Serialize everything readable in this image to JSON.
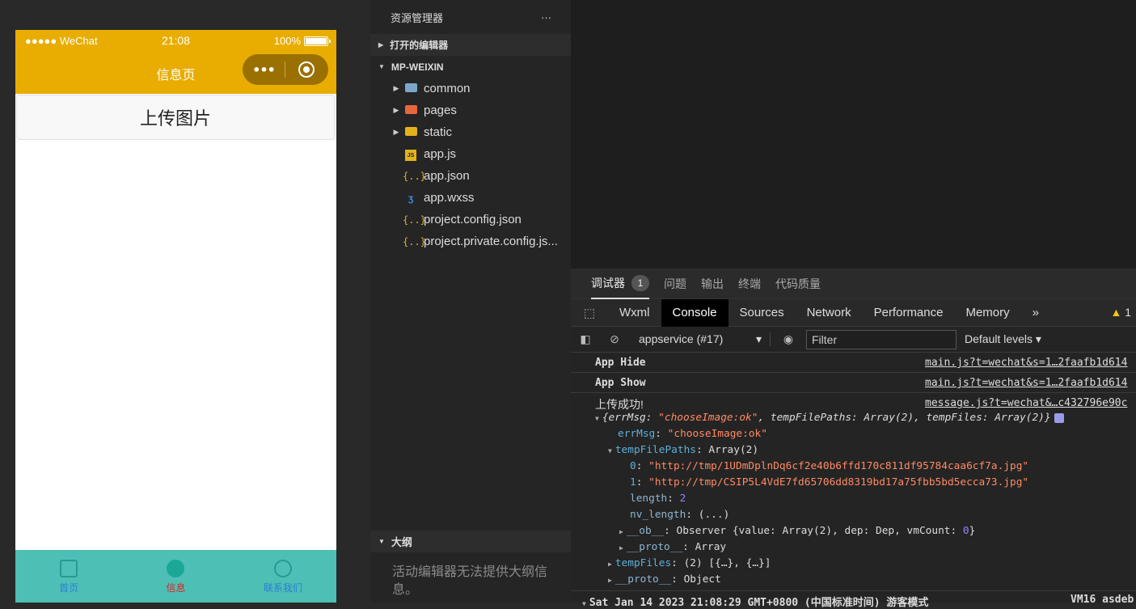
{
  "simulator": {
    "status": {
      "carrier": "●●●●● WeChat",
      "time": "21:08",
      "battery": "100%"
    },
    "nav_title": "信息页",
    "capsule_dots": "•••",
    "upload_button": "上传图片",
    "tabs": [
      {
        "label": "首页"
      },
      {
        "label": "信息"
      },
      {
        "label": "联系我们"
      }
    ]
  },
  "explorer": {
    "title": "资源管理器",
    "more": "···",
    "open_editors": "打开的编辑器",
    "project": "MP-WEIXIN",
    "items": [
      {
        "name": "common",
        "icon": "folder-icon",
        "color": "#7aa7c7"
      },
      {
        "name": "pages",
        "icon": "folder-icon",
        "color": "#e8663c"
      },
      {
        "name": "static",
        "icon": "folder-icon",
        "color": "#e2b21b"
      },
      {
        "name": "app.js",
        "icon": "js-file-icon"
      },
      {
        "name": "app.json",
        "icon": "json-file-icon"
      },
      {
        "name": "app.wxss",
        "icon": "wxss-file-icon"
      },
      {
        "name": "project.config.json",
        "icon": "json-file-icon"
      },
      {
        "name": "project.private.config.js...",
        "icon": "json-file-icon"
      }
    ],
    "outline_title": "大纲",
    "outline_message": "活动编辑器无法提供大纲信息。"
  },
  "debugger": {
    "top_tabs": [
      {
        "label": "调试器",
        "badge": "1"
      },
      {
        "label": "问题"
      },
      {
        "label": "输出"
      },
      {
        "label": "终端"
      },
      {
        "label": "代码质量"
      }
    ],
    "dev_tabs": [
      "Wxml",
      "Console",
      "Sources",
      "Network",
      "Performance",
      "Memory"
    ],
    "more": "»",
    "warnings": "1",
    "context": "appservice (#17)",
    "filter_placeholder": "Filter",
    "levels": "Default levels ▾",
    "rows": [
      {
        "message": "App Hide",
        "source": "main.js?t=wechat&s=1…2faafb1d614"
      },
      {
        "message": "App Show",
        "source": "main.js?t=wechat&s=1…2faafb1d614"
      }
    ],
    "log": {
      "message": "上传成功!",
      "source": "message.js?t=wechat&…c432796e90c",
      "summary_open": "{errMsg: ",
      "summary_errmsg": "\"chooseImage:ok\"",
      "summary_rest": ", tempFilePaths: Array(2), tempFiles: Array(2)}",
      "errMsg_key": "errMsg",
      "errMsg_val": "\"chooseImage:ok\"",
      "tempFilePaths_key": "tempFilePaths",
      "tempFilePaths_val": "Array(2)",
      "path0_key": "0",
      "path0_val": "\"http://tmp/1UDmDplnDq6cf2e40b6ffd170c811df95784caa6cf7a.jpg\"",
      "path1_key": "1",
      "path1_val": "\"http://tmp/CSIP5L4VdE7fd65706dd8319bd17a75fbb5bd5ecca73.jpg\"",
      "length_key": "length",
      "length_val": "2",
      "nvlength_key": "nv_length",
      "nvlength_val": "(...)",
      "ob_key": "__ob__",
      "ob_val_pre": "Observer {value: Array(2), dep: Dep, vmCount: ",
      "ob_vmcount": "0",
      "ob_val_post": "}",
      "proto_key": "__proto__",
      "proto_val": "Array",
      "tempFiles_key": "tempFiles",
      "tempFiles_val": "(2) [{…}, {…}]",
      "proto2_key": "__proto__",
      "proto2_val": "Object"
    },
    "bottom": {
      "message": "Sat Jan 14 2023 21:08:29 GMT+0800 (中国标准时间) 游客模式",
      "source": "VM16 asdeb"
    }
  }
}
